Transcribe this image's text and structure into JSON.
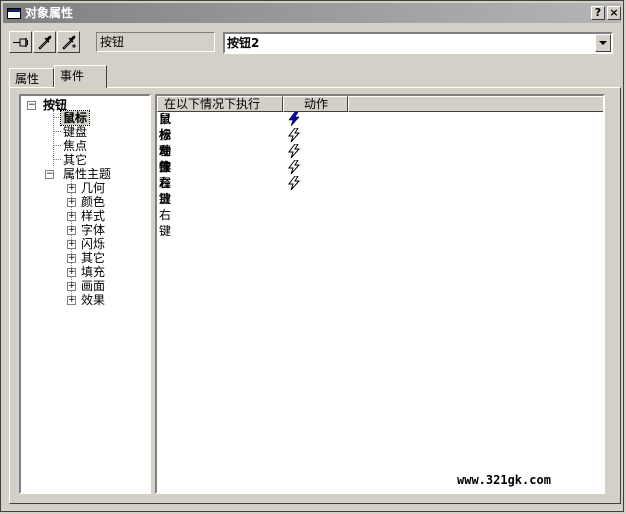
{
  "window": {
    "title": "对象属性"
  },
  "titlebar": {
    "help": "?",
    "close": "×"
  },
  "toolbar": {
    "buttons": [
      "pin-icon",
      "eyedropper-icon",
      "eyedropper-plus-icon"
    ]
  },
  "object_type": "按钮",
  "object_name": "按钮2",
  "tabs": [
    {
      "label": "属性"
    },
    {
      "label": "事件"
    }
  ],
  "tree": {
    "root": "按钮",
    "items": [
      "鼠标",
      "键盘",
      "焦点",
      "其它"
    ],
    "theme": {
      "label": "属性主题",
      "children": [
        "几何",
        "颜色",
        "样式",
        "字体",
        "闪烁",
        "其它",
        "填充",
        "画面",
        "效果"
      ]
    }
  },
  "list": {
    "headers": {
      "condition": "在以下情况下执行",
      "action": "动作"
    },
    "rows": [
      {
        "label": "鼠标动作",
        "bold": true,
        "icon": "lightning-icon",
        "accent": "#0000cc"
      },
      {
        "label": "按左键",
        "bold": false,
        "icon": "lightning-outline-icon"
      },
      {
        "label": "释放左键",
        "bold": false,
        "icon": "lightning-outline-icon"
      },
      {
        "label": "按右键",
        "bold": false,
        "icon": "lightning-outline-icon"
      },
      {
        "label": "释放右键",
        "bold": false,
        "icon": "lightning-outline-icon"
      }
    ]
  },
  "watermark": "www.321gk.com"
}
